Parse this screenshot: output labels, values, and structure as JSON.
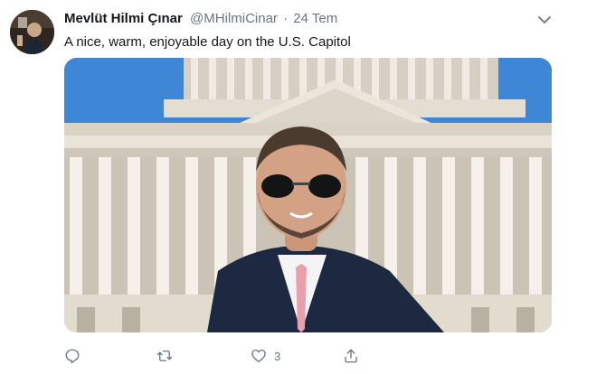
{
  "tweet": {
    "author": {
      "display_name": "Mevlüt Hilmi Çınar",
      "handle": "@MHilmiCinar"
    },
    "separator": "·",
    "date": "24 Tem",
    "text": "A nice, warm, enjoyable day on the U.S. Capitol",
    "media": {
      "description_icon": "photo"
    },
    "actions": {
      "reply": {
        "icon": "reply-icon",
        "count": ""
      },
      "retweet": {
        "icon": "retweet-icon",
        "count": ""
      },
      "like": {
        "icon": "heart-icon",
        "count": "3"
      },
      "share": {
        "icon": "share-icon",
        "count": ""
      }
    }
  },
  "colors": {
    "text_primary": "#14171a",
    "text_secondary": "#657786",
    "sky": "#3d87d6"
  }
}
